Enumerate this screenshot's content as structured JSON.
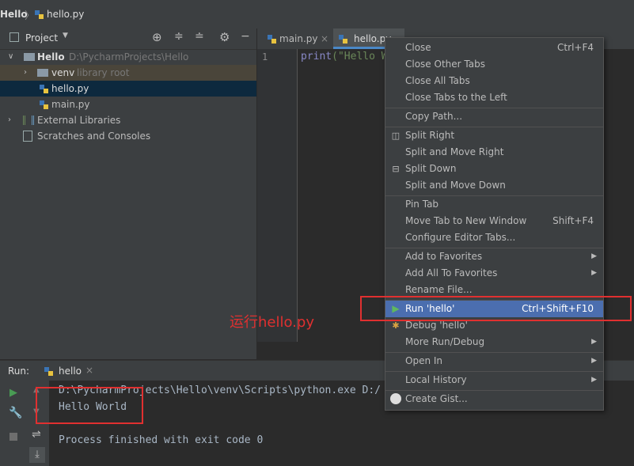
{
  "breadcrumb": {
    "project": "Hello",
    "file": "hello.py"
  },
  "project_panel": {
    "title": "Project",
    "tree": {
      "root_name": "Hello",
      "root_path": "D:\\PycharmProjects\\Hello",
      "venv_name": "venv",
      "venv_note": "library root",
      "file1": "hello.py",
      "file2": "main.py",
      "external": "External Libraries",
      "scratches": "Scratches and Consoles"
    }
  },
  "editor": {
    "tabs": {
      "tab1": "main.py",
      "tab2": "hello.py"
    },
    "line_number": "1",
    "code_fn": "print",
    "code_str": "(\"Hello W"
  },
  "context_menu": {
    "close": "Close",
    "close_sc": "Ctrl+F4",
    "close_other": "Close Other Tabs",
    "close_all": "Close All Tabs",
    "close_left": "Close Tabs to the Left",
    "copy_path": "Copy Path...",
    "split_right": "Split Right",
    "split_move_right": "Split and Move Right",
    "split_down": "Split Down",
    "split_move_down": "Split and Move Down",
    "pin_tab": "Pin Tab",
    "move_tab": "Move Tab to New Window",
    "move_tab_sc": "Shift+F4",
    "configure_tabs": "Configure Editor Tabs...",
    "add_fav": "Add to Favorites",
    "add_all_fav": "Add All To Favorites",
    "rename": "Rename File...",
    "run": "Run 'hello'",
    "run_sc": "Ctrl+Shift+F10",
    "debug": "Debug 'hello'",
    "more_run": "More Run/Debug",
    "open_in": "Open In",
    "local_history": "Local History",
    "create_gist": "Create Gist..."
  },
  "annotation": "运行hello.py",
  "run_panel": {
    "label": "Run:",
    "tab": "hello",
    "console": {
      "line1": "D:\\PycharmProjects\\Hello\\venv\\Scripts\\python.exe D:/",
      "line2": "Hello World",
      "line3": "",
      "line4": "Process finished with exit code 0"
    }
  },
  "colors": {
    "accent": "#4b6eaf",
    "annotation_red": "#e03030",
    "run_green": "#499c54"
  }
}
